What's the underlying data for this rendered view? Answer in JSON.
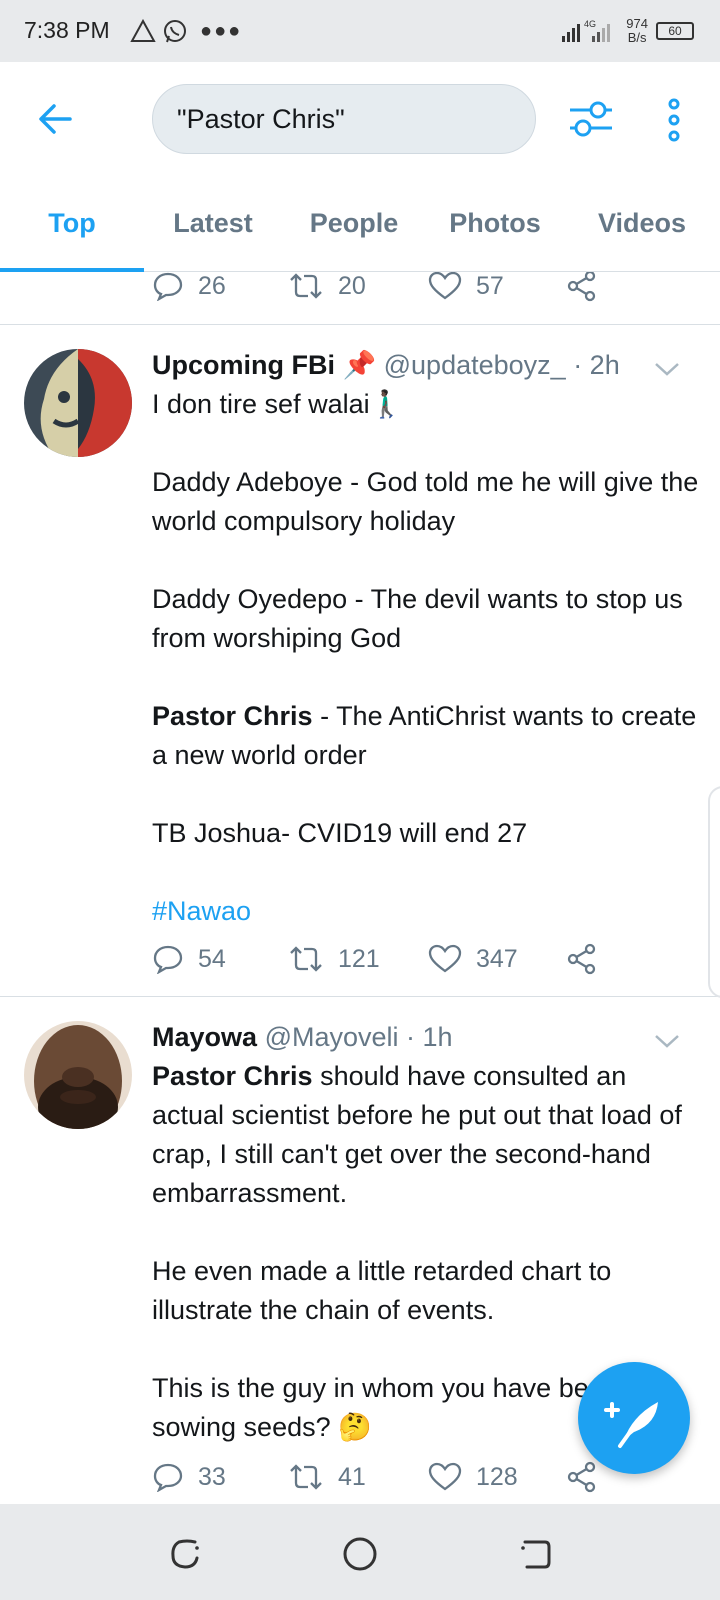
{
  "status_bar": {
    "time": "7:38 PM",
    "network": "4G",
    "speed_value": "974",
    "speed_unit": "B/s",
    "battery": "60",
    "icons": [
      "warning-triangle-icon",
      "whatsapp-icon",
      "more-notifications-icon",
      "signal-icon",
      "battery-icon"
    ]
  },
  "header": {
    "search_query": "\"Pastor Chris\"",
    "icons": [
      "back-arrow-icon",
      "filter-sliders-icon",
      "more-vertical-icon"
    ]
  },
  "tabs": [
    {
      "label": "Top",
      "active": true
    },
    {
      "label": "Latest",
      "active": false
    },
    {
      "label": "People",
      "active": false
    },
    {
      "label": "Photos",
      "active": false
    },
    {
      "label": "Videos",
      "active": false
    }
  ],
  "partial_tweet_actions": {
    "replies": "26",
    "retweets": "20",
    "likes": "57"
  },
  "tweets": [
    {
      "name": "Upcoming FBi 📌",
      "handle": "@updateboyz_",
      "time": "· 2h",
      "body": {
        "line1": "I don tire sef walai🚶🏿‍♂️",
        "p2": "Daddy Adeboye - God told me he will give the world compulsory holiday",
        "p3": "Daddy Oyedepo - The devil wants to stop us from worshiping God",
        "p4_bold": "Pastor Chris",
        "p4_rest": " - The AntiChrist wants to create a new world order",
        "p5": "TB Joshua- CVID19 will end 27",
        "hashtag": "#Nawao"
      },
      "replies": "54",
      "retweets": "121",
      "likes": "347"
    },
    {
      "name": "Mayowa",
      "handle": "@Mayoveli",
      "time": "· 1h",
      "body": {
        "p1_bold": "Pastor Chris",
        "p1_rest": " should have consulted an actual scientist before he put out that load of crap, I still can't get over the second-hand embarrassment.",
        "p2": "He even made a little retarded chart to illustrate the chain of events.",
        "p3": "This is the guy in whom you have been sowing seeds? 🤔"
      },
      "replies": "33",
      "retweets": "41",
      "likes": "128"
    }
  ],
  "colors": {
    "accent": "#1da1f2",
    "secondary_text": "#657786",
    "primary_text": "#14171a"
  }
}
